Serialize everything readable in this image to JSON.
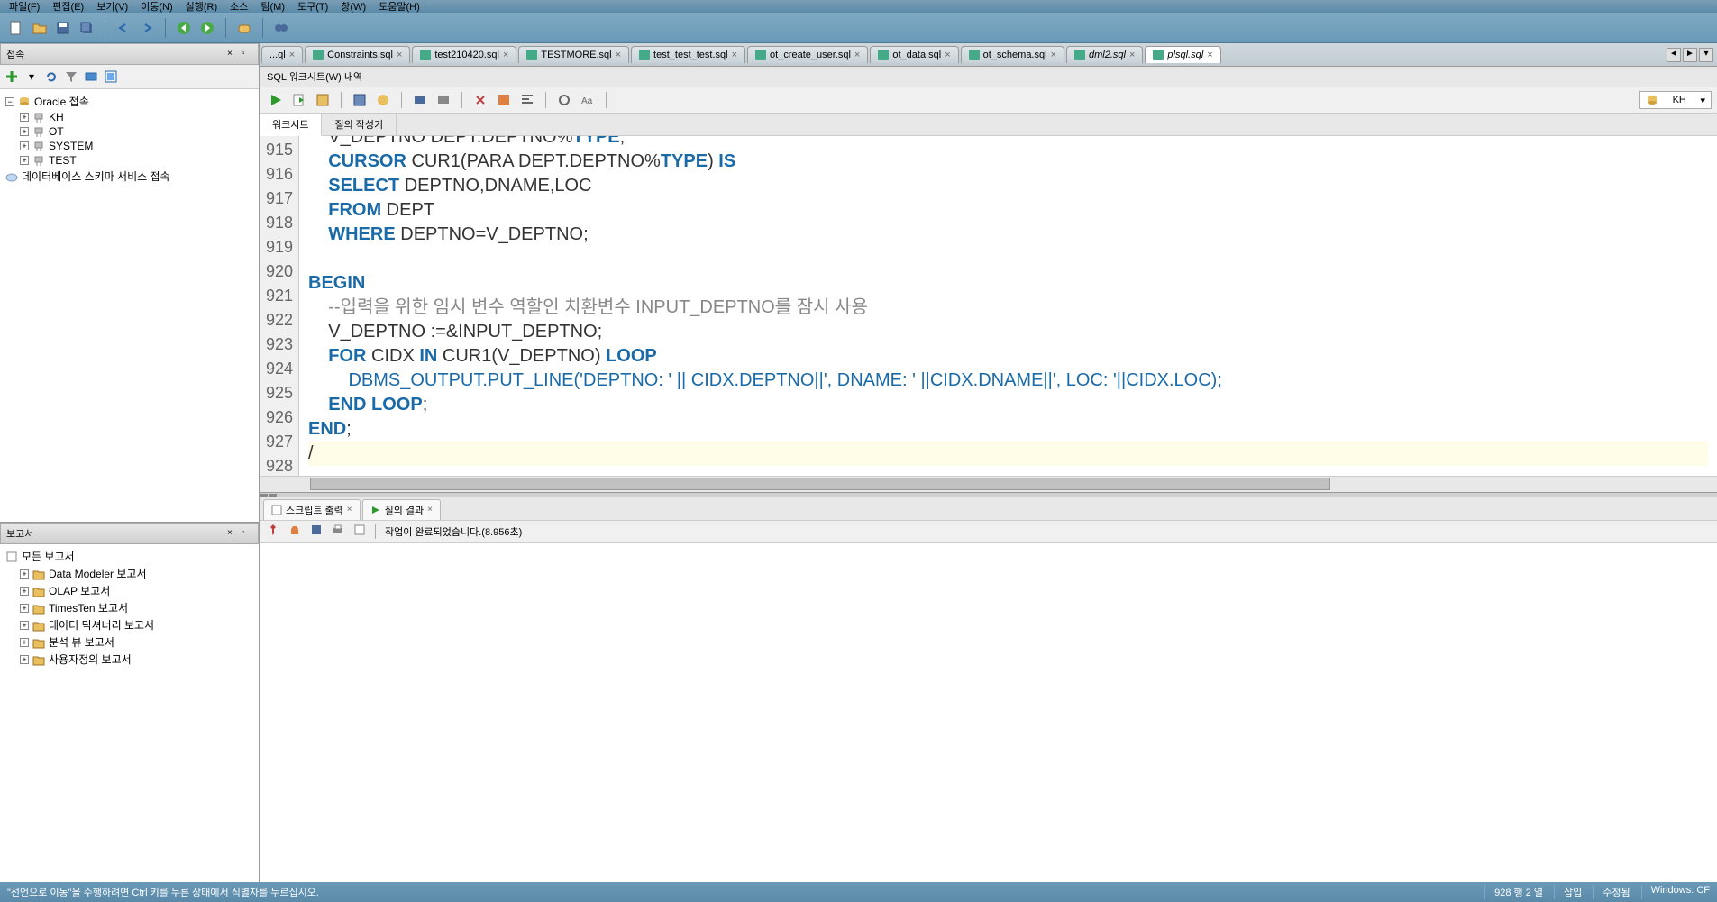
{
  "menu": {
    "items": [
      "파일(F)",
      "편집(E)",
      "보기(V)",
      "이동(N)",
      "실행(R)",
      "소스",
      "팀(M)",
      "도구(T)",
      "창(W)",
      "도움말(H)"
    ]
  },
  "left": {
    "connections_title": "접속",
    "conn_tree": {
      "root": "Oracle 접속",
      "items": [
        "KH",
        "OT",
        "SYSTEM",
        "TEST"
      ],
      "schema_service": "데이터베이스 스키마 서비스 접속"
    },
    "reports_title": "보고서",
    "reports": [
      "모든 보고서",
      "Data Modeler 보고서",
      "OLAP 보고서",
      "TimesTen 보고서",
      "데이터 딕셔너리 보고서",
      "분석 뷰 보고서",
      "사용자정의 보고서"
    ]
  },
  "tabs": [
    {
      "label": "...ql",
      "icon": false
    },
    {
      "label": "Constraints.sql"
    },
    {
      "label": "test210420.sql"
    },
    {
      "label": "TESTMORE.sql"
    },
    {
      "label": "test_test_test.sql"
    },
    {
      "label": "ot_create_user.sql"
    },
    {
      "label": "ot_data.sql"
    },
    {
      "label": "ot_schema.sql"
    },
    {
      "label": "dml2.sql",
      "italic": true
    },
    {
      "label": "plsql.sql",
      "active": true
    }
  ],
  "breadcrumb": "SQL 워크시트(W) 내역",
  "ws_tabs": {
    "worksheet": "워크시트",
    "query_builder": "질의 작성기"
  },
  "connection_selector": "KH",
  "code_lines": [
    {
      "n": 915,
      "seg": [
        [
          "    ",
          ""
        ],
        [
          "V_DEPTNO DEPT.DEPTNO%",
          "txt"
        ],
        [
          "TYPE",
          "kw"
        ],
        [
          ";",
          "txt"
        ]
      ],
      "cut": true
    },
    {
      "n": 916,
      "seg": [
        [
          "    ",
          ""
        ],
        [
          "CURSOR",
          "kw"
        ],
        [
          " CUR1(PARA DEPT.DEPTNO%",
          "txt"
        ],
        [
          "TYPE",
          "kw"
        ],
        [
          ") ",
          "txt"
        ],
        [
          "IS",
          "kw"
        ]
      ]
    },
    {
      "n": 917,
      "seg": [
        [
          "    ",
          ""
        ],
        [
          "SELECT",
          "kw"
        ],
        [
          " DEPTNO,DNAME,LOC",
          "txt"
        ]
      ]
    },
    {
      "n": 918,
      "seg": [
        [
          "    ",
          ""
        ],
        [
          "FROM",
          "kw"
        ],
        [
          " DEPT",
          "txt"
        ]
      ]
    },
    {
      "n": 919,
      "seg": [
        [
          "    ",
          ""
        ],
        [
          "WHERE",
          "kw"
        ],
        [
          " DEPTNO=V_DEPTNO;",
          "txt"
        ]
      ]
    },
    {
      "n": 920,
      "seg": [
        [
          "",
          ""
        ]
      ]
    },
    {
      "n": 921,
      "seg": [
        [
          "BEGIN",
          "kw"
        ]
      ]
    },
    {
      "n": 922,
      "seg": [
        [
          "    --입력을 위한 임시 변수 역할인 치환변수 INPUT_DEPTNO를 잠시 사용",
          "comment"
        ]
      ]
    },
    {
      "n": 923,
      "seg": [
        [
          "    V_DEPTNO :=&INPUT_DEPTNO;",
          "txt"
        ]
      ]
    },
    {
      "n": 924,
      "seg": [
        [
          "    ",
          ""
        ],
        [
          "FOR",
          "kw"
        ],
        [
          " CIDX ",
          "txt"
        ],
        [
          "IN",
          "kw"
        ],
        [
          " CUR1(V_DEPTNO) ",
          "txt"
        ],
        [
          "LOOP",
          "kw"
        ]
      ]
    },
    {
      "n": 925,
      "seg": [
        [
          "        DBMS_OUTPUT.PUT_LINE('DEPTNO: ' || CIDX.DEPTNO||', DNAME: ' ||CIDX.DNAME||', LOC: '||CIDX.LOC);",
          "ident"
        ]
      ]
    },
    {
      "n": 926,
      "seg": [
        [
          "    ",
          ""
        ],
        [
          "END LOOP",
          "kw"
        ],
        [
          ";",
          "txt"
        ]
      ]
    },
    {
      "n": 927,
      "seg": [
        [
          "END",
          "kw"
        ],
        [
          ";",
          "txt"
        ]
      ]
    },
    {
      "n": 928,
      "seg": [
        [
          "/",
          "txt"
        ]
      ],
      "current": true
    }
  ],
  "output": {
    "tab1": "스크립트 출력",
    "tab2": "질의 결과",
    "status": "작업이 완료되었습니다.(8.956초)"
  },
  "statusbar": {
    "hint": "\"선언으로 이동\"을 수행하려면 Ctrl 키를 누른 상태에서 식별자를 누르십시오.",
    "pos": "928 행 2 열",
    "mode": "삽입",
    "modified": "수정됨",
    "os": "Windows: CF"
  }
}
